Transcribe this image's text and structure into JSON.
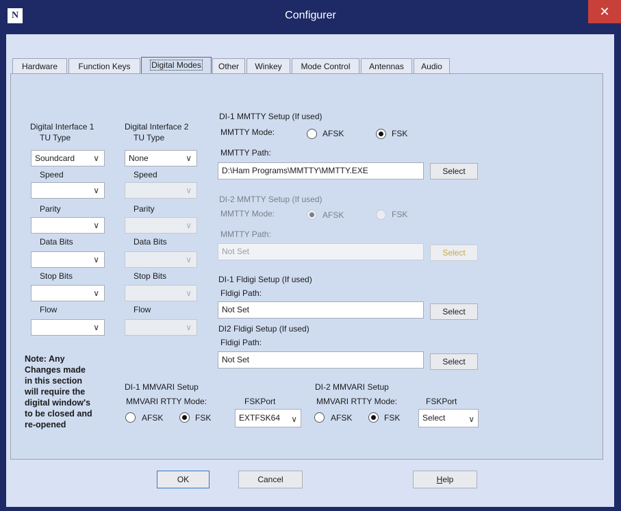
{
  "window": {
    "title": "Configurer",
    "icon": "app-logo-icon",
    "close_glyph": "✕"
  },
  "tabs": [
    {
      "label": "Hardware",
      "active": false
    },
    {
      "label": "Function Keys",
      "active": false
    },
    {
      "label": "Digital Modes",
      "active": true
    },
    {
      "label": "Other",
      "active": false
    },
    {
      "label": "Winkey",
      "active": false
    },
    {
      "label": "Mode Control",
      "active": false
    },
    {
      "label": "Antennas",
      "active": false
    },
    {
      "label": "Audio",
      "active": false
    }
  ],
  "di1": {
    "heading": "Digital Interface 1",
    "tu_label": "TU Type",
    "tu_value": "Soundcard",
    "speed_label": "Speed",
    "speed_value": "",
    "parity_label": "Parity",
    "parity_value": "",
    "databits_label": "Data Bits",
    "databits_value": "",
    "stopbits_label": "Stop Bits",
    "stopbits_value": "",
    "flow_label": "Flow",
    "flow_value": ""
  },
  "di2": {
    "heading": "Digital Interface 2",
    "tu_label": "TU Type",
    "tu_value": "None",
    "speed_label": "Speed",
    "parity_label": "Parity",
    "databits_label": "Data Bits",
    "stopbits_label": "Stop Bits",
    "flow_label": "Flow"
  },
  "note": [
    "Note: Any",
    "Changes made",
    "in this section",
    "will require the",
    "digital window's",
    "to be closed and",
    "re-opened"
  ],
  "mmtty1": {
    "heading": "DI-1 MMTTY Setup (If used)",
    "mode_label": "MMTTY Mode:",
    "afsk": "AFSK",
    "fsk": "FSK",
    "selected": "FSK",
    "path_label": "MMTTY Path:",
    "path_value": "D:\\Ham Programs\\MMTTY\\MMTTY.EXE",
    "select": "Select"
  },
  "mmtty2": {
    "heading": "DI-2 MMTTY Setup (If used)",
    "mode_label": "MMTTY Mode:",
    "afsk": "AFSK",
    "fsk": "FSK",
    "selected": "AFSK",
    "path_label": "MMTTY Path:",
    "path_value": "Not Set",
    "select": "Select"
  },
  "fldigi1": {
    "heading": "DI-1 Fldigi Setup (If used)",
    "path_label": "Fldigi Path:",
    "path_value": "Not Set",
    "select": "Select"
  },
  "fldigi2": {
    "heading": "DI2 Fldigi Setup (If used)",
    "path_label": "Fldigi Path:",
    "path_value": "Not Set",
    "select": "Select"
  },
  "mmvari1": {
    "heading": "DI-1 MMVARI Setup",
    "mode_label": "MMVARI RTTY Mode:",
    "afsk": "AFSK",
    "fsk": "FSK",
    "selected": "FSK",
    "port_label": "FSKPort",
    "port_value": "EXTFSK64"
  },
  "mmvari2": {
    "heading": "DI-2 MMVARI Setup",
    "mode_label": "MMVARI RTTY Mode:",
    "afsk": "AFSK",
    "fsk": "FSK",
    "selected": "FSK",
    "port_label": "FSKPort",
    "port_value": "Select"
  },
  "footer": {
    "ok": "OK",
    "cancel": "Cancel",
    "help_h": "H",
    "help_rest": "elp"
  },
  "colors": {
    "titlebar": "#1e2a66",
    "client": "#d8e2f4",
    "panel": "#cfdcf0",
    "close": "#c7403a"
  }
}
